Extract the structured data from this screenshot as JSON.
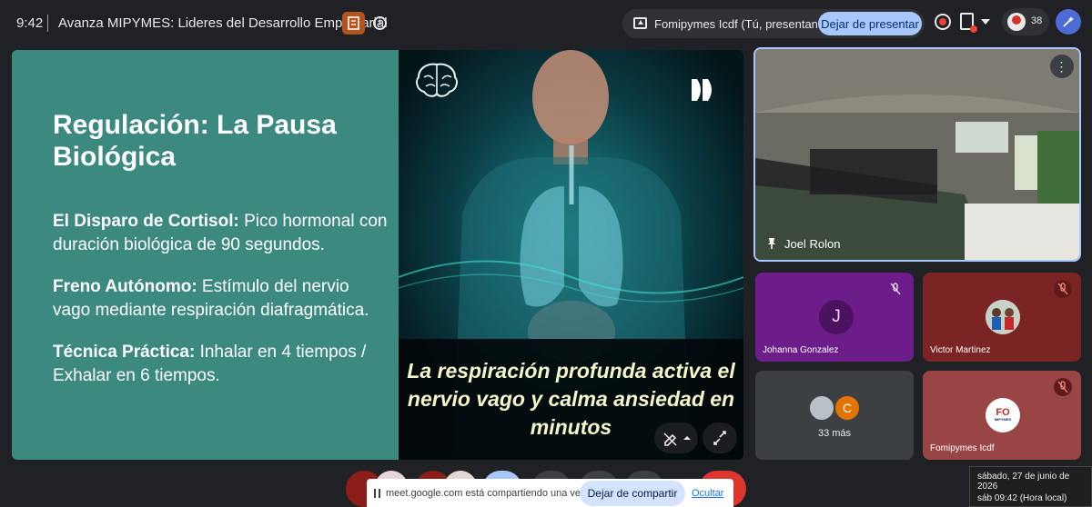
{
  "header": {
    "time": "9:42",
    "meeting_title": "Avanza MIPYMES: Lideres del Desarrollo Empresarial",
    "presenting_label": "Fomipymes Icdf (Tú, presentando)",
    "stop_presenting": "Dejar de presentar",
    "participant_count": "38"
  },
  "slide": {
    "title": "Regulación: La Pausa Biológica",
    "bullets": [
      {
        "term": "El Disparo de Cortisol:",
        "text": " Pico hormonal con duración biológica de 90 segundos."
      },
      {
        "term": "Freno Autónomo:",
        "text": " Estímulo del nervio vago mediante respiración diafragmática."
      },
      {
        "term": "Técnica Práctica:",
        "text": " Inhalar en 4 tiempos / Exhalar en 6 tiempos."
      }
    ],
    "image_caption": "La respiración profunda activa el nervio vago y calma ansiedad en minutos"
  },
  "tiles": {
    "main_name": "Joel Rolon",
    "j_initial": "J",
    "j_name": "Johanna Gonzalez",
    "v_name": "Victor Martinez",
    "others_initial": "C",
    "others_count": "33 más",
    "f_name": "Fomipymes Icdf",
    "f_logo_top": "FO",
    "f_logo_bottom": "MIPYMES"
  },
  "share_bar": {
    "text": "meet.google.com está compartiendo una ventana.",
    "stop_label": "Dejar de compartir",
    "hide_label": "Ocultar"
  },
  "datetime": {
    "line1": "sábado, 27 de junio de 2026",
    "line2": "sáb 09:42 (Hora local)"
  },
  "colors": {
    "slide_bg": "#3c8a7f",
    "accent_blue": "#a8c7fa",
    "record_red": "#ea4335"
  }
}
